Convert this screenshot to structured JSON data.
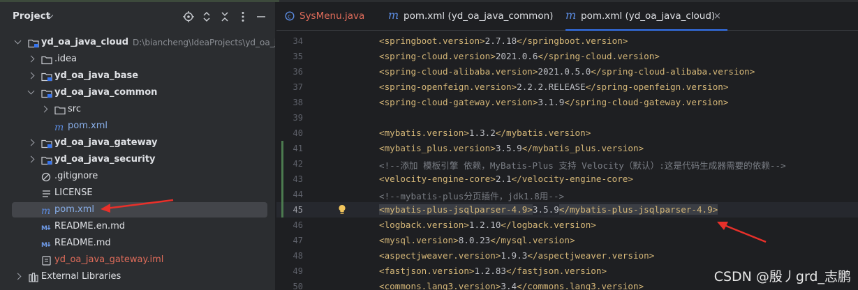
{
  "project_panel": {
    "title": "Project",
    "tree": [
      {
        "depth": 0,
        "expand": "down",
        "icon": "module-folder",
        "label": "yd_oa_java_cloud",
        "bold": true,
        "path": "D:\\biancheng\\IdeaProjects\\yd_oa_jav"
      },
      {
        "depth": 1,
        "expand": "right",
        "icon": "folder",
        "label": ".idea",
        "bold": false
      },
      {
        "depth": 1,
        "expand": "right",
        "icon": "module-folder",
        "label": "yd_oa_java_base",
        "bold": true
      },
      {
        "depth": 1,
        "expand": "down",
        "icon": "module-folder",
        "label": "yd_oa_java_common",
        "bold": true
      },
      {
        "depth": 2,
        "expand": "right",
        "icon": "folder",
        "label": "src",
        "bold": false
      },
      {
        "depth": 2,
        "expand": "none",
        "icon": "maven",
        "label": "pom.xml",
        "bold": false,
        "color": "blue"
      },
      {
        "depth": 1,
        "expand": "right",
        "icon": "module-folder",
        "label": "yd_oa_java_gateway",
        "bold": true
      },
      {
        "depth": 1,
        "expand": "right",
        "icon": "module-folder",
        "label": "yd_oa_java_security",
        "bold": true
      },
      {
        "depth": 1,
        "expand": "none",
        "icon": "ignore",
        "label": ".gitignore",
        "bold": false
      },
      {
        "depth": 1,
        "expand": "none",
        "icon": "text",
        "label": "LICENSE",
        "bold": false
      },
      {
        "depth": 1,
        "expand": "none",
        "icon": "maven",
        "label": "pom.xml",
        "bold": false,
        "color": "blue",
        "selected": true
      },
      {
        "depth": 1,
        "expand": "none",
        "icon": "markdown",
        "label": "README.en.md",
        "bold": false
      },
      {
        "depth": 1,
        "expand": "none",
        "icon": "markdown",
        "label": "README.md",
        "bold": false
      },
      {
        "depth": 1,
        "expand": "none",
        "icon": "iml",
        "label": "yd_oa_java_gateway.iml",
        "bold": false,
        "color": "red"
      },
      {
        "depth": 0,
        "expand": "right",
        "icon": "library",
        "label": "External Libraries",
        "bold": false
      }
    ]
  },
  "tabs": [
    {
      "label": "SysMenu.java",
      "icon": "java-class-icon",
      "color": "#e06c5a",
      "active": false
    },
    {
      "label": "pom.xml (yd_oa_java_common)",
      "icon": "maven-icon",
      "color": "#dfe1e5",
      "active": false
    },
    {
      "label": "pom.xml (yd_oa_java_cloud)",
      "icon": "maven-icon",
      "color": "#dfe1e5",
      "active": true,
      "close": "×"
    }
  ],
  "editor": {
    "current_line": 45,
    "lines": [
      {
        "n": 34,
        "parts": [
          [
            "tag",
            "<springboot.version>"
          ],
          [
            "txt",
            "2.7.18"
          ],
          [
            "tag",
            "</springboot.version>"
          ]
        ]
      },
      {
        "n": 35,
        "parts": [
          [
            "tag",
            "<spring-cloud.version>"
          ],
          [
            "txt",
            "2021.0.6"
          ],
          [
            "tag",
            "</spring-cloud.version>"
          ]
        ]
      },
      {
        "n": 36,
        "parts": [
          [
            "tag",
            "<spring-cloud-alibaba.version>"
          ],
          [
            "txt",
            "2021.0.5.0"
          ],
          [
            "tag",
            "</spring-cloud-alibaba.version>"
          ]
        ]
      },
      {
        "n": 37,
        "parts": [
          [
            "tag",
            "<spring-openfeign.version>"
          ],
          [
            "txt",
            "2.2.2.RELEASE"
          ],
          [
            "tag",
            "</spring-openfeign.version>"
          ]
        ]
      },
      {
        "n": 38,
        "parts": [
          [
            "tag",
            "<spring-cloud-gateway.version>"
          ],
          [
            "txt",
            "3.1.9"
          ],
          [
            "tag",
            "</spring-cloud-gateway.version>"
          ]
        ]
      },
      {
        "n": 39,
        "parts": []
      },
      {
        "n": 40,
        "parts": [
          [
            "tag",
            "<mybatis.version>"
          ],
          [
            "txt",
            "1.3.2"
          ],
          [
            "tag",
            "</mybatis.version>"
          ]
        ]
      },
      {
        "n": 41,
        "parts": [
          [
            "tag",
            "<mybatis_plus.version>"
          ],
          [
            "txt",
            "3.5.9"
          ],
          [
            "tag",
            "</mybatis_plus.version>"
          ]
        ]
      },
      {
        "n": 42,
        "parts": [
          [
            "cmt",
            "<!--添加 模板引擎 依赖，MyBatis-Plus 支持 Velocity（默认）:这是代码生成器需要的依赖-->"
          ]
        ]
      },
      {
        "n": 43,
        "parts": [
          [
            "tag",
            "<velocity-engine-core>"
          ],
          [
            "txt",
            "2.1"
          ],
          [
            "tag",
            "</velocity-engine-core>"
          ]
        ]
      },
      {
        "n": 44,
        "parts": [
          [
            "cmt",
            "<!--mybatis-plus分页插件，jdk1.8用-->"
          ]
        ]
      },
      {
        "n": 45,
        "parts": [
          [
            "hl",
            "<mybatis-plus-jsqlparser-4.9>"
          ],
          [
            "txt",
            "3.5.9"
          ],
          [
            "hl",
            "</mybatis-plus-jsqlparser-4.9>"
          ]
        ]
      },
      {
        "n": 46,
        "parts": [
          [
            "tag",
            "<logback.version>"
          ],
          [
            "txt",
            "1.2.10"
          ],
          [
            "tag",
            "</logback.version>"
          ]
        ]
      },
      {
        "n": 47,
        "parts": [
          [
            "tag",
            "<mysql.version>"
          ],
          [
            "txt",
            "8.0.23"
          ],
          [
            "tag",
            "</mysql.version>"
          ]
        ]
      },
      {
        "n": 48,
        "parts": [
          [
            "tag",
            "<aspectjweaver.version>"
          ],
          [
            "txt",
            "1.9.3"
          ],
          [
            "tag",
            "</aspectjweaver.version>"
          ]
        ]
      },
      {
        "n": 49,
        "parts": [
          [
            "tag",
            "<fastjson.version>"
          ],
          [
            "txt",
            "1.2.83"
          ],
          [
            "tag",
            "</fastjson.version>"
          ]
        ]
      },
      {
        "n": 50,
        "parts": [
          [
            "tag",
            "<commons.lang3.version>"
          ],
          [
            "txt",
            "3.4"
          ],
          [
            "tag",
            "</commons.lang3.version>"
          ]
        ]
      }
    ],
    "changed_lines": [
      41,
      42,
      43,
      44,
      45
    ]
  },
  "watermark": "CSDN @殷丿grd_志鹏",
  "colors": {
    "accent": "#3574f0",
    "annotation_arrow": "#e8302a",
    "tag": "#d5b778",
    "comment": "#7a7e85"
  }
}
